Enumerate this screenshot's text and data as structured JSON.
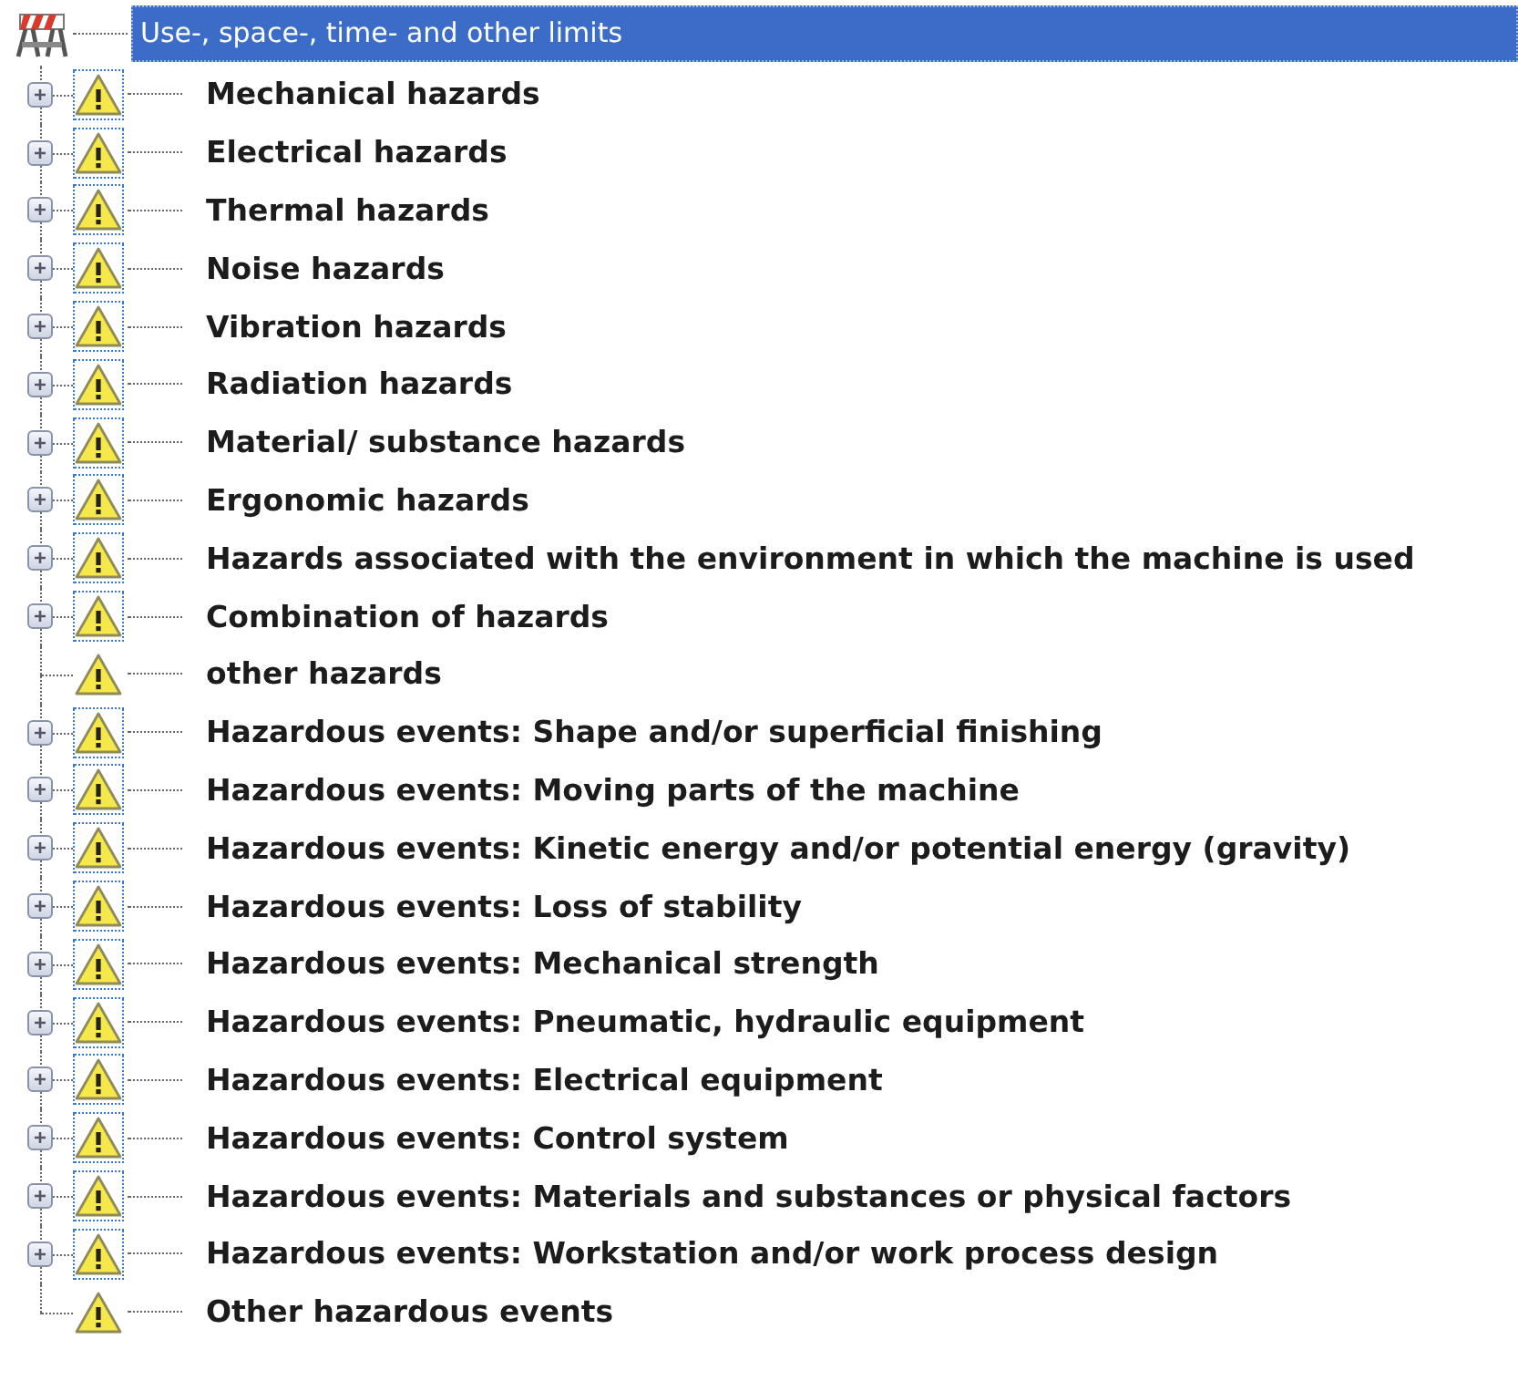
{
  "tree": {
    "label": "Use-, space-, time- and other limits",
    "selected": true,
    "children": [
      {
        "label": "Mechanical hazards",
        "expandable": true,
        "selected": false
      },
      {
        "label": "Electrical hazards",
        "expandable": true,
        "selected": false
      },
      {
        "label": "Thermal hazards",
        "expandable": true,
        "selected": false
      },
      {
        "label": "Noise hazards",
        "expandable": true,
        "selected": false
      },
      {
        "label": "Vibration hazards",
        "expandable": true,
        "selected": false
      },
      {
        "label": "Radiation hazards",
        "expandable": true,
        "selected": false
      },
      {
        "label": "Material/ substance hazards",
        "expandable": true,
        "selected": false
      },
      {
        "label": "Ergonomic hazards",
        "expandable": true,
        "selected": false
      },
      {
        "label": "Hazards associated with the environment in which the machine is used",
        "expandable": true,
        "selected": false
      },
      {
        "label": "Combination of hazards",
        "expandable": true,
        "selected": false
      },
      {
        "label": "other hazards",
        "expandable": false,
        "selected": false
      },
      {
        "label": "Hazardous events: Shape and/or superficial finishing",
        "expandable": true,
        "selected": false
      },
      {
        "label": "Hazardous events: Moving parts of the machine",
        "expandable": true,
        "selected": false
      },
      {
        "label": "Hazardous events: Kinetic energy and/or potential energy (gravity)",
        "expandable": true,
        "selected": false
      },
      {
        "label": "Hazardous events: Loss of stability",
        "expandable": true,
        "selected": false
      },
      {
        "label": "Hazardous events: Mechanical strength",
        "expandable": true,
        "selected": false
      },
      {
        "label": "Hazardous events: Pneumatic, hydraulic equipment",
        "expandable": true,
        "selected": false
      },
      {
        "label": "Hazardous events: Electrical equipment",
        "expandable": true,
        "selected": false
      },
      {
        "label": "Hazardous events: Control system",
        "expandable": true,
        "selected": false
      },
      {
        "label": "Hazardous events: Materials and substances or physical factors",
        "expandable": true,
        "selected": false
      },
      {
        "label": "Hazardous events: Workstation and/or work process design",
        "expandable": true,
        "selected": false
      },
      {
        "label": "Other hazardous events",
        "expandable": false,
        "selected": false
      }
    ]
  }
}
